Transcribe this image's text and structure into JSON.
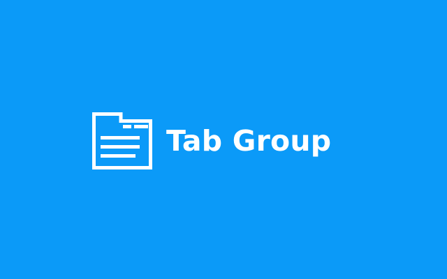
{
  "colors": {
    "background": "#0b9af8",
    "foreground": "#ffffff"
  },
  "logo": {
    "icon": "tab-group-icon",
    "text": "Tab Group"
  }
}
